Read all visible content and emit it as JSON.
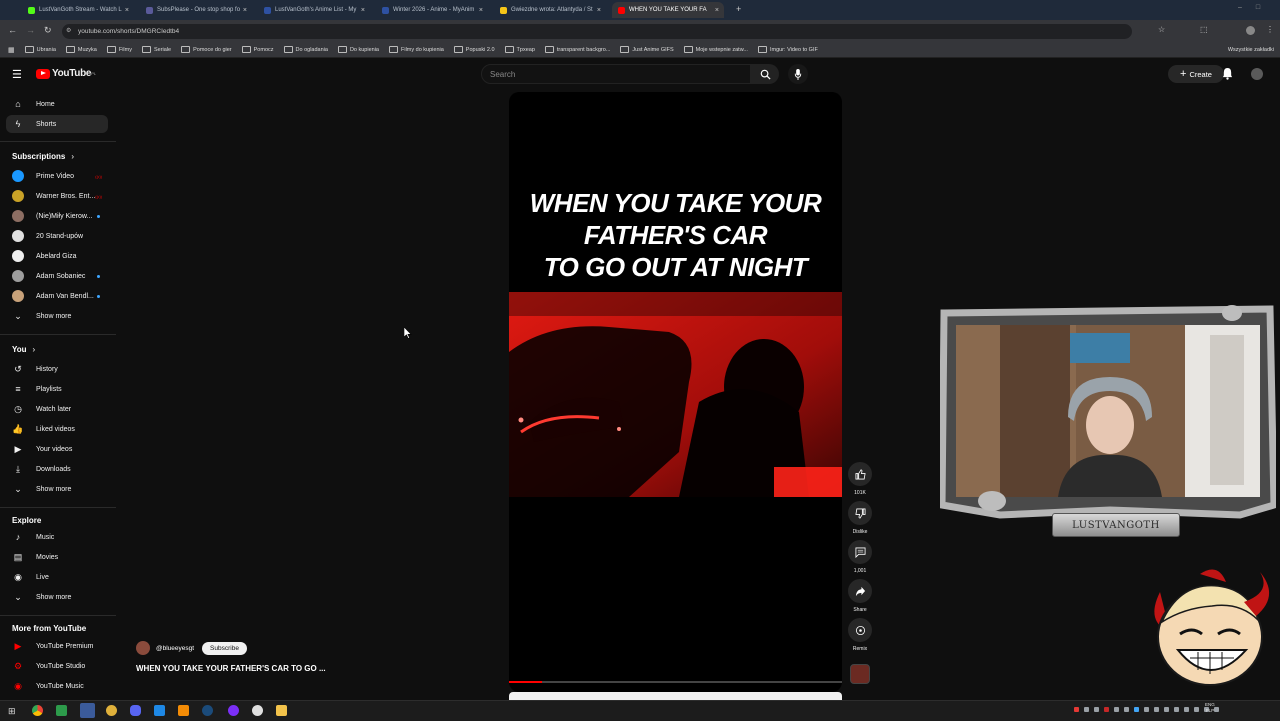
{
  "browser": {
    "tabs": [
      {
        "title": "LustVanGoth Stream - Watch L",
        "color": "#53fc18"
      },
      {
        "title": "SubsPlease - One stop shop fo",
        "color": "#5a5a9a"
      },
      {
        "title": "LustVanGoth's Anime List - My",
        "color": "#2e51a2"
      },
      {
        "title": "Winter 2026 - Anime - MyAnim",
        "color": "#2e51a2"
      },
      {
        "title": "Gwiezdne wrota: Atlantyda / St",
        "color": "#f5c518"
      },
      {
        "title": "WHEN YOU TAKE YOUR FA",
        "color": "#ff0000",
        "active": true
      }
    ],
    "url": "youtube.com/shorts/DMGRCIedtb4",
    "bookmarks": [
      "Ubrania",
      "Muzyka",
      "Filmy",
      "Seriale",
      "Pomoce do gier",
      "Pomocz",
      "Do ogladania",
      "Do kupienia",
      "Filmy do kupienia",
      "Popuski 2.0",
      "Tpxeap",
      "transparent backgro...",
      "Just Anime GIFS",
      "Moje wstepnie zatw...",
      "Imgur: Video to GIF"
    ],
    "all_bookmarks": "Wszystkie zakładki"
  },
  "yt": {
    "logo_text": "YouTube",
    "logo_region": "PL",
    "search_placeholder": "Search",
    "create_label": "Create"
  },
  "sidebar": {
    "main": [
      {
        "label": "Home",
        "icon": "home-icon"
      },
      {
        "label": "Shorts",
        "icon": "shorts-icon",
        "active": true
      }
    ],
    "subscriptions_header": "Subscriptions",
    "subscriptions": [
      {
        "label": "Prime Video",
        "color": "#1a98ff",
        "badge": "live"
      },
      {
        "label": "Warner Bros. Ent...",
        "color": "#c9a227",
        "badge": "live"
      },
      {
        "label": "(Nie)Miły Kierow...",
        "color": "#8d6e63",
        "badge": "dot"
      },
      {
        "label": "20 Stand-upów",
        "color": "#e0e0e0",
        "badge": ""
      },
      {
        "label": "Abelard Giza",
        "color": "#eeeeee",
        "badge": ""
      },
      {
        "label": "Adam Sobaniec",
        "color": "#9e9e9e",
        "badge": "dot"
      },
      {
        "label": "Adam Van Bendl...",
        "color": "#c8a27a",
        "badge": "dot"
      }
    ],
    "show_more": "Show more",
    "you_header": "You",
    "you": [
      {
        "label": "History",
        "icon": "history-icon"
      },
      {
        "label": "Playlists",
        "icon": "playlists-icon"
      },
      {
        "label": "Watch later",
        "icon": "watch-later-icon"
      },
      {
        "label": "Liked videos",
        "icon": "liked-videos-icon"
      },
      {
        "label": "Your videos",
        "icon": "your-videos-icon"
      },
      {
        "label": "Downloads",
        "icon": "downloads-icon"
      }
    ],
    "explore_header": "Explore",
    "explore": [
      {
        "label": "Music",
        "icon": "music-icon"
      },
      {
        "label": "Movies",
        "icon": "movies-icon"
      },
      {
        "label": "Live",
        "icon": "live-icon"
      }
    ],
    "more_header": "More from YouTube",
    "more": [
      {
        "label": "YouTube Premium",
        "icon": "yt-premium-icon"
      },
      {
        "label": "YouTube Studio",
        "icon": "yt-studio-icon"
      },
      {
        "label": "YouTube Music",
        "icon": "yt-music-icon"
      }
    ]
  },
  "short": {
    "overlay_lines": [
      "WHEN YOU TAKE YOUR",
      "FATHER'S CAR",
      "TO GO OUT AT NIGHT"
    ],
    "channel": "@blueeyesgt",
    "subscribe_label": "Subscribe",
    "caption": "WHEN YOU TAKE YOUR FATHER'S CAR TO GO ...",
    "progress": 0.1,
    "actions": {
      "likes": "101K",
      "dislike": "Dislike",
      "comments": "1,001",
      "share": "Share",
      "remix": "Remix"
    }
  },
  "overlay": {
    "name_plate": "LUSTVANGOTH"
  },
  "taskbar": {
    "lang": "ENG",
    "region": "PLP"
  },
  "colors": {
    "background": "#0f0f0f",
    "accent_red": "#ff0000",
    "scene_red": "#c4140f"
  }
}
